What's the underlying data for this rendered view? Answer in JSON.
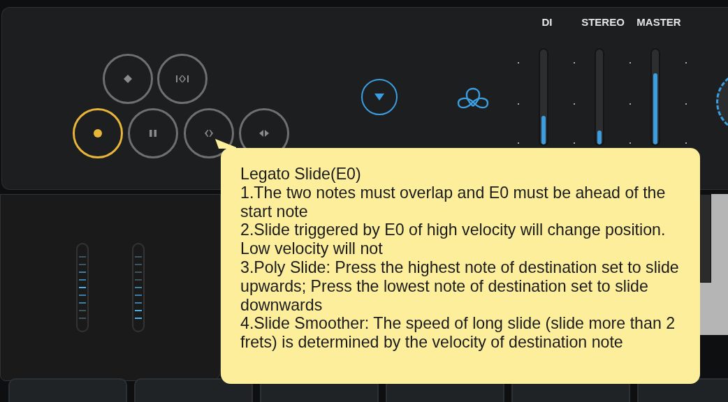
{
  "transport_buttons": [
    {
      "kind": "marker",
      "selected": false
    },
    {
      "kind": "bounds",
      "selected": false
    },
    {
      "kind": "record",
      "selected": true
    },
    {
      "kind": "pause",
      "selected": false
    },
    {
      "kind": "slide",
      "selected": false
    },
    {
      "kind": "pan",
      "selected": false
    }
  ],
  "meters": [
    {
      "label": "DI",
      "level": 0.3
    },
    {
      "label": "STEREO",
      "level": 0.15
    },
    {
      "label": "MASTER",
      "level": 0.75
    }
  ],
  "tooltip": {
    "title": "Legato Slide(E0)",
    "lines": [
      "1.The two notes must overlap and E0 must be ahead of the start note",
      "2.Slide triggered by E0 of high velocity will change position. Low velocity will not",
      "3.Poly Slide: Press the highest note of destination set to slide upwards; Press the lowest note of destination set to slide downwards",
      "4.Slide Smoother: The speed of long slide (slide more than 2 frets) is determined by the velocity of destination note"
    ]
  }
}
